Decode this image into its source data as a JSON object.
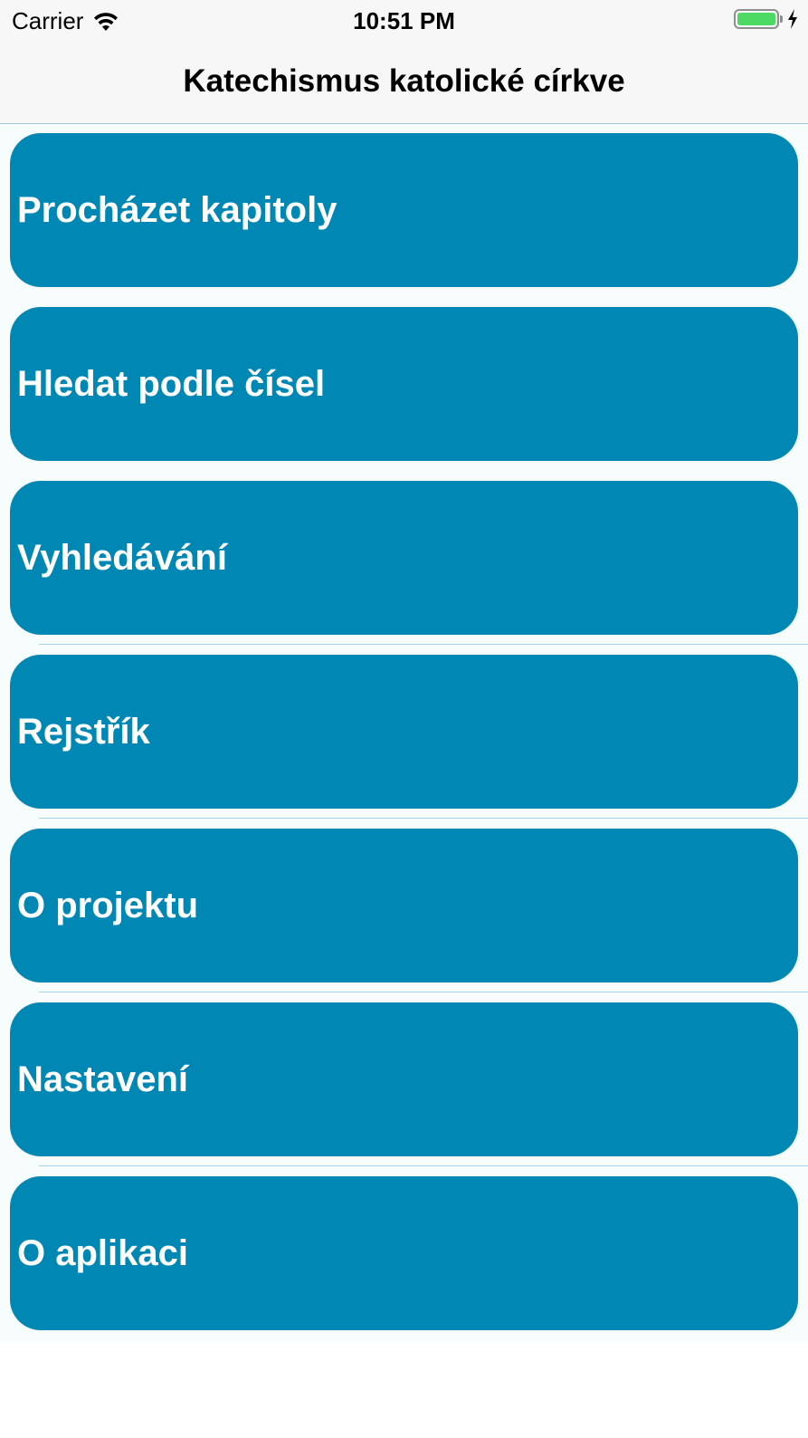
{
  "status_bar": {
    "carrier": "Carrier",
    "time": "10:51 PM",
    "wifi_icon": "wifi-icon",
    "battery_icon": "battery-icon",
    "charging_icon": "bolt-icon",
    "battery_level": 1.0
  },
  "nav": {
    "title": "Katechismus katolické církve"
  },
  "menu": {
    "items": [
      {
        "label": "Procházet kapitoly"
      },
      {
        "label": "Hledat podle čísel"
      },
      {
        "label": "Vyhledávání"
      },
      {
        "label": "Rejstřík"
      },
      {
        "label": "O projektu"
      },
      {
        "label": "Nastavení"
      },
      {
        "label": "O aplikaci"
      }
    ]
  },
  "colors": {
    "button_bg": "#0187b4",
    "button_text": "#ffffff",
    "list_bg": "#f6fdfc",
    "bar_bg": "#f7f7f7",
    "battery_green": "#4cd964"
  }
}
